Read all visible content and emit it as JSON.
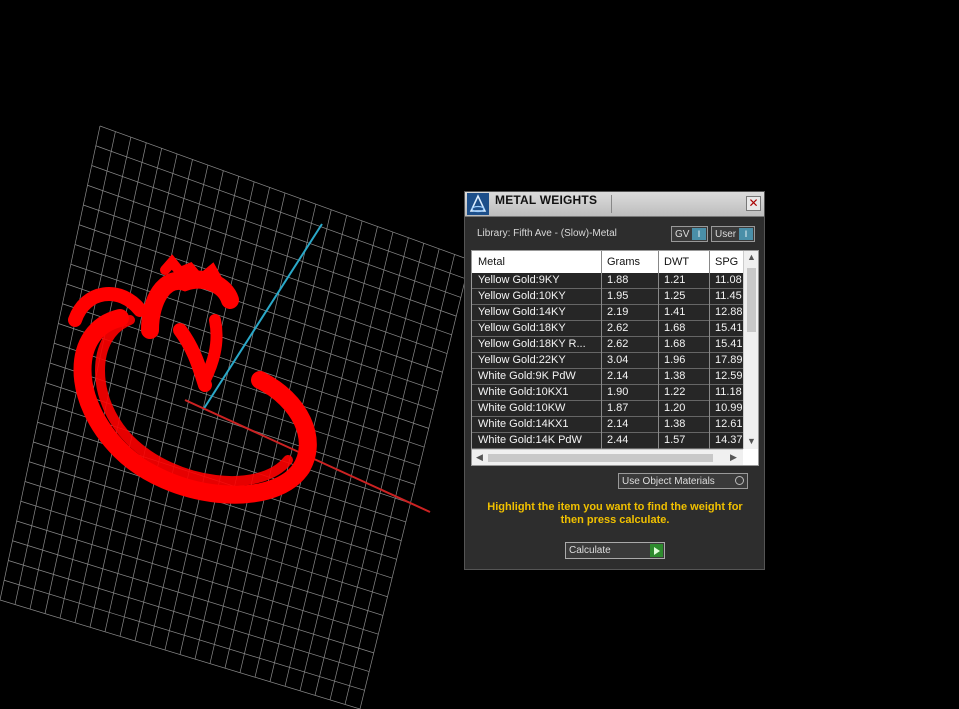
{
  "panel": {
    "title": "METAL WEIGHTS",
    "close_glyph": "✕",
    "library_label": "Library: Fifth Ave - (Slow)-Metal",
    "toggle_gv": "GV",
    "toggle_user": "User",
    "toggle_indicator": "I",
    "columns": [
      "Metal",
      "Grams",
      "DWT",
      "SPG"
    ],
    "rows": [
      [
        "Yellow Gold:9KY",
        "1.88",
        "1.21",
        "11.08"
      ],
      [
        "Yellow Gold:10KY",
        "1.95",
        "1.25",
        "11.45"
      ],
      [
        "Yellow Gold:14KY",
        "2.19",
        "1.41",
        "12.88"
      ],
      [
        "Yellow Gold:18KY",
        "2.62",
        "1.68",
        "15.41"
      ],
      [
        "Yellow Gold:18KY R...",
        "2.62",
        "1.68",
        "15.41"
      ],
      [
        "Yellow Gold:22KY",
        "3.04",
        "1.96",
        "17.89"
      ],
      [
        "White Gold:9K PdW",
        "2.14",
        "1.38",
        "12.59"
      ],
      [
        "White Gold:10KX1",
        "1.90",
        "1.22",
        "11.18"
      ],
      [
        "White Gold:10KW",
        "1.87",
        "1.20",
        "10.99"
      ],
      [
        "White Gold:14KX1",
        "2.14",
        "1.38",
        "12.61"
      ],
      [
        "White Gold:14K PdW",
        "2.44",
        "1.57",
        "14.37"
      ]
    ],
    "use_object_materials": "Use Object Materials",
    "hint": "Highlight the item you want to find the weight for then press calculate.",
    "calculate": "Calculate"
  },
  "icons": {
    "app_logo": "app-logo-icon",
    "close": "close-icon",
    "scroll_up": "chevron-up-icon",
    "scroll_down": "chevron-down-icon",
    "scroll_left": "chevron-left-icon",
    "scroll_right": "chevron-right-icon",
    "calculate_go": "play-icon"
  },
  "colors": {
    "viewport_bg": "#000000",
    "ring": "#ff0000",
    "grid": "#8a8a8a",
    "axis_x": "#cc2222",
    "axis_y": "#2aa8c8",
    "panel_bg": "#2d2d2d",
    "hint_text": "#f0c000"
  }
}
